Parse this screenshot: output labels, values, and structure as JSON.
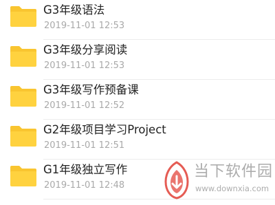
{
  "files": [
    {
      "name": "G3年级语法",
      "date": "2019-11-01 12:53"
    },
    {
      "name": "G3年级分享阅读",
      "date": "2019-11-01 12:53"
    },
    {
      "name": "G3年级写作预备课",
      "date": "2019-11-01 12:52"
    },
    {
      "name": "G2年级项目学习Project",
      "date": "2019-11-01 12:51"
    },
    {
      "name": "G1年级独立写作",
      "date": "2019-11-01 12:48"
    }
  ],
  "icons": {
    "file_icon": "folder-icon",
    "watermark_logo": "downxia-logo"
  },
  "colors": {
    "folder_yellow": "#FFD23F",
    "folder_back": "#F9C530",
    "name_text": "#222222",
    "date_text": "#A9A9A9",
    "watermark": "#9A9A9A",
    "watermark_logo": "#E0392F"
  },
  "watermark": {
    "title": "当下软件园",
    "url": "www.downxia.com"
  }
}
